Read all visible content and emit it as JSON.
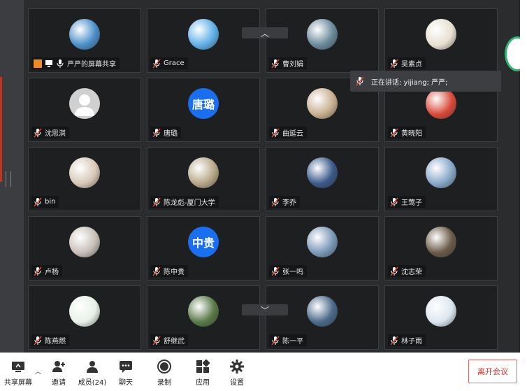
{
  "speaking_banner": "正在讲话: yijiang; 严严;",
  "tiles": [
    {
      "name": "严严的屏幕共享",
      "avatar": "photo",
      "color": "#4a8fc9",
      "icons": "share"
    },
    {
      "name": "Grace",
      "avatar": "photo",
      "color": "#5fb0e8"
    },
    {
      "name": "曹刘娟",
      "avatar": "photo",
      "color": "#6a8a9a"
    },
    {
      "name": "吴素贞",
      "avatar": "photo",
      "color": "#e8e0d0"
    },
    {
      "name": "沈思淇",
      "avatar": "default",
      "color": "#d0d0d0"
    },
    {
      "name": "唐璐",
      "avatar": "text",
      "text": "唐璐",
      "color": "#1a6ff0"
    },
    {
      "name": "曲延云",
      "avatar": "photo",
      "color": "#c8b090"
    },
    {
      "name": "黄晓阳",
      "avatar": "photo",
      "color": "#d94a3a"
    },
    {
      "name": "bin",
      "avatar": "photo",
      "color": "#d8c8b8"
    },
    {
      "name": "陈龙彪-厦门大学",
      "avatar": "photo",
      "color": "#b8a888"
    },
    {
      "name": "李乔",
      "avatar": "photo",
      "color": "#3a5a8a"
    },
    {
      "name": "王莺子",
      "avatar": "photo",
      "color": "#88a8c8"
    },
    {
      "name": "卢杨",
      "avatar": "photo",
      "color": "#c8c0b8"
    },
    {
      "name": "陈中贵",
      "avatar": "text",
      "text": "中贵",
      "color": "#1a6ff0"
    },
    {
      "name": "张一鸣",
      "avatar": "photo",
      "color": "#7a98b8"
    },
    {
      "name": "沈志荣",
      "avatar": "photo",
      "color": "#6a5a48"
    },
    {
      "name": "陈燕燃",
      "avatar": "photo",
      "color": "#e8f0e8"
    },
    {
      "name": "舒继武",
      "avatar": "photo",
      "color": "#5a7a48"
    },
    {
      "name": "陈一平",
      "avatar": "photo",
      "color": "#4a6a8a"
    },
    {
      "name": "林子雨",
      "avatar": "photo",
      "color": "#dce6f0"
    }
  ],
  "toolbar": {
    "share": "共享屏幕",
    "invite": "邀请",
    "members": "成员(24)",
    "chat": "聊天",
    "record": "录制",
    "apps": "应用",
    "settings": "设置",
    "leave": "离开会议"
  }
}
